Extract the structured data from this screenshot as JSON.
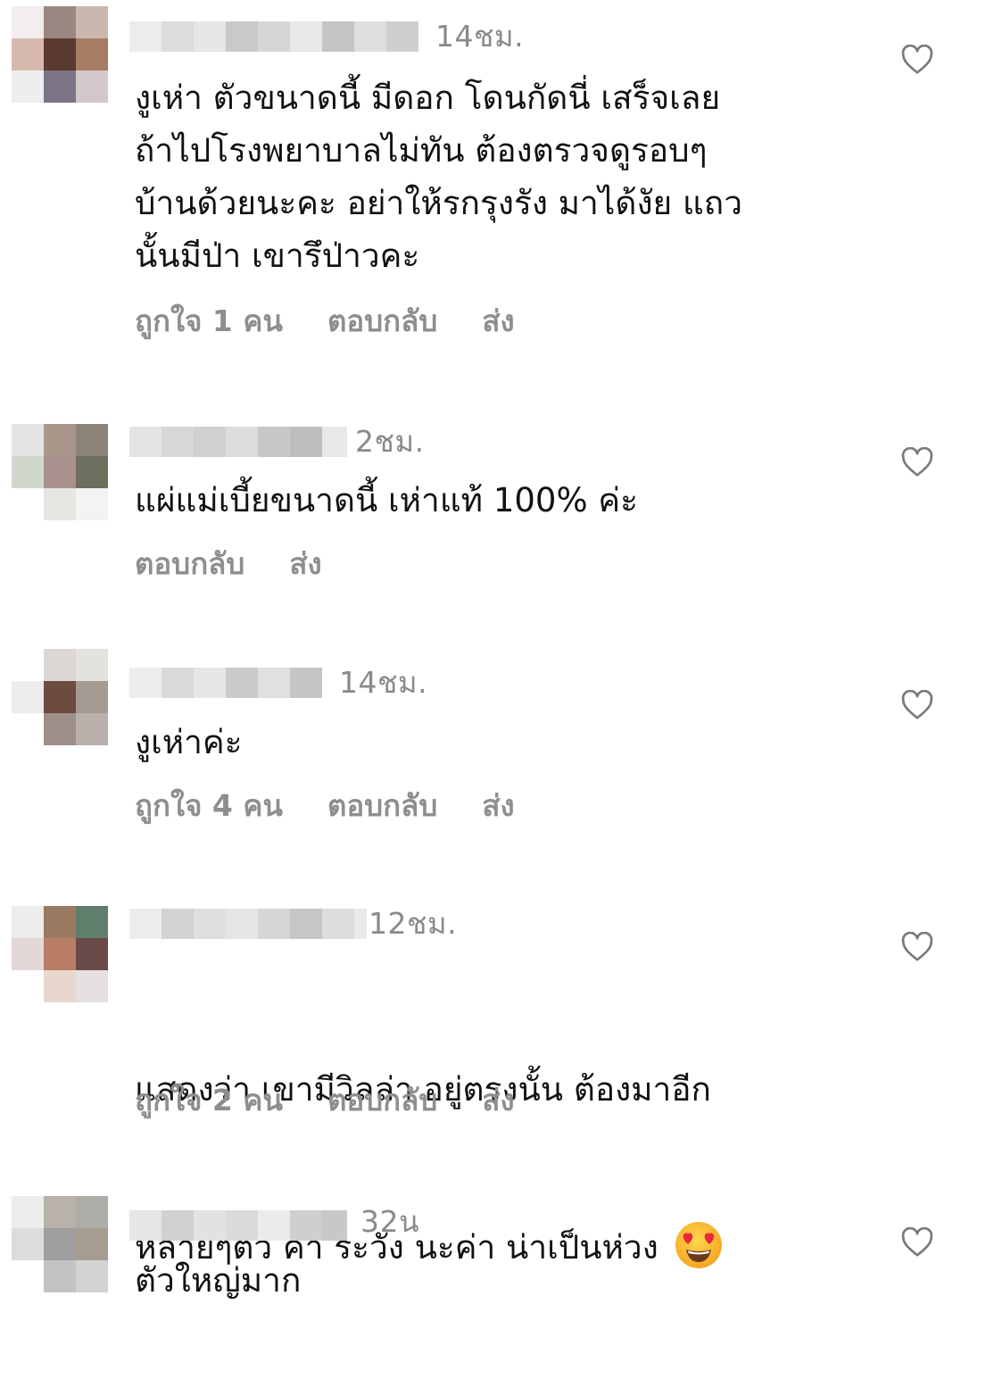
{
  "comments": [
    {
      "time": "14ชม.",
      "text": "งูเห่า ตัวขนาดนี้ มีดอก โดนกัดนี่ เสร็จเลย\nถ้าไปโรงพยาบาลไม่ทัน ต้องตรวจดูรอบๆ\nบ้านด้วยนะคะ อย่าให้รกรุงรัง มาได้งัย แถว\nนั้นมีป่า เขารึป่าวคะ",
      "likes": "ถูกใจ 1 คน",
      "reply": "ตอบกลับ",
      "send": "ส่ง"
    },
    {
      "time": "2ชม.",
      "text": "แผ่แม่เบี้ยขนาดนี้ เห่าแท้ 100% ค่ะ",
      "reply": "ตอบกลับ",
      "send": "ส่ง"
    },
    {
      "time": "14ชม.",
      "text": "งูเห่าค่ะ",
      "likes": "ถูกใจ 4 คน",
      "reply": "ตอบกลับ",
      "send": "ส่ง"
    },
    {
      "time": "12ชม.",
      "text_line1": "แสดงว่า เขามีวิลล่า อยู่ตรงนั้น ต้องมาอีก",
      "text_line2": "หลายๆตัว ค่า ระวัง นะค่า น่าเป็นห่วง",
      "emoji": "heart-eyes-emoji",
      "likes": "ถูกใจ 2 คน",
      "reply": "ตอบกลับ",
      "send": "ส่ง"
    },
    {
      "time": "32น",
      "text": "ตัวใหญ่มาก"
    }
  ],
  "icons": {
    "like": "heart-outline-icon"
  },
  "colors": {
    "text": "#111111",
    "meta": "#8e8e8e",
    "background": "#ffffff"
  }
}
